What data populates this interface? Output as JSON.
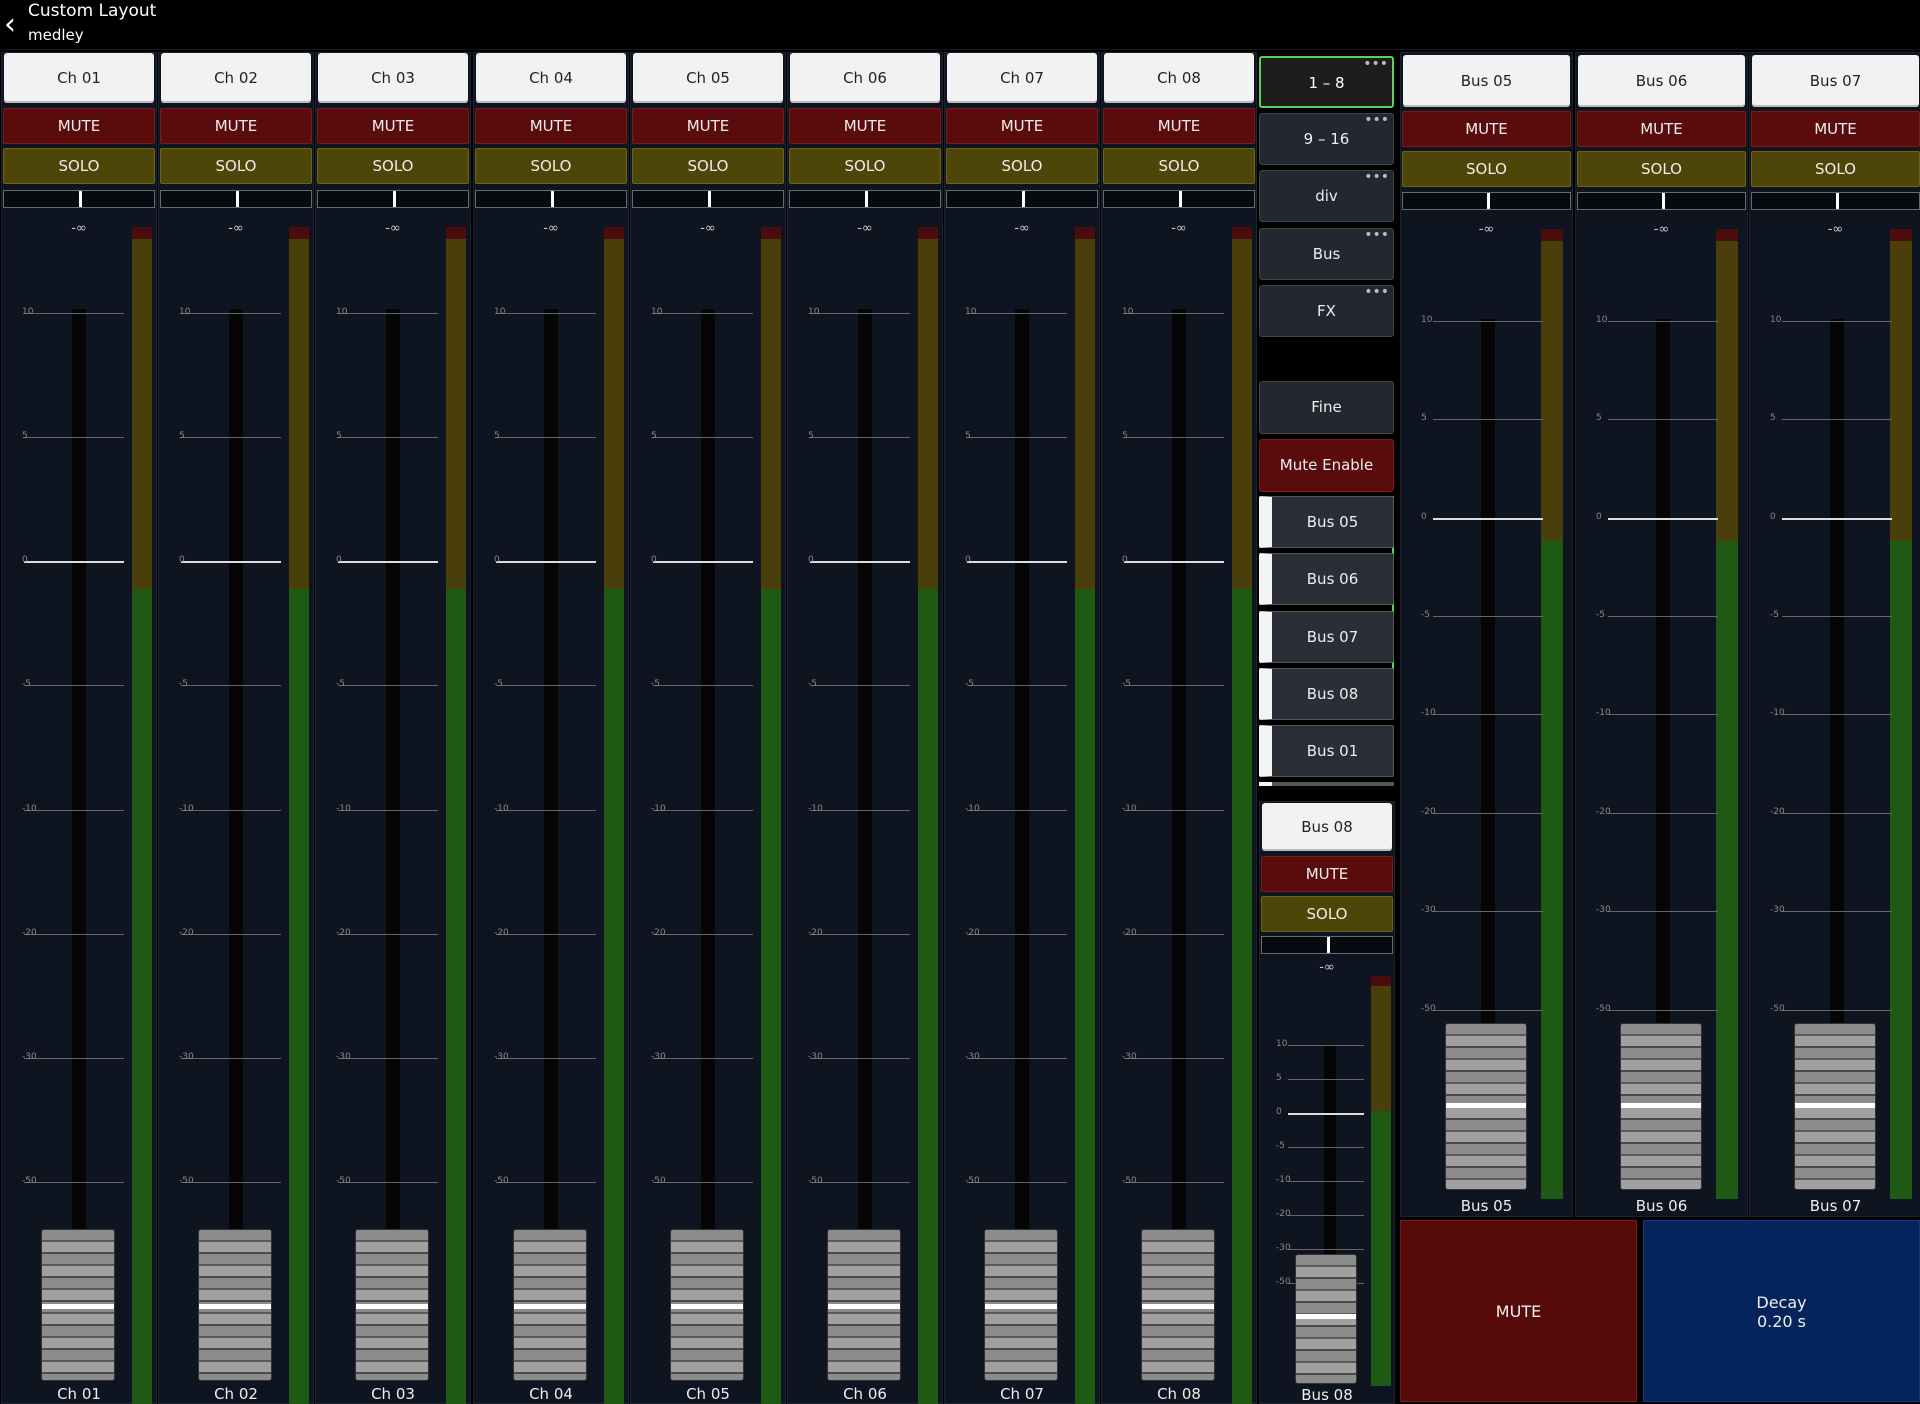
{
  "header": {
    "back_icon": "chevron-left-icon",
    "title": "Custom Layout",
    "subtitle": "medley"
  },
  "channels": [
    {
      "name": "Ch 01",
      "mute": "MUTE",
      "solo": "SOLO",
      "level": "-∞",
      "label": "Ch 01"
    },
    {
      "name": "Ch 02",
      "mute": "MUTE",
      "solo": "SOLO",
      "level": "-∞",
      "label": "Ch 02"
    },
    {
      "name": "Ch 03",
      "mute": "MUTE",
      "solo": "SOLO",
      "level": "-∞",
      "label": "Ch 03"
    },
    {
      "name": "Ch 04",
      "mute": "MUTE",
      "solo": "SOLO",
      "level": "-∞",
      "label": "Ch 04"
    },
    {
      "name": "Ch 05",
      "mute": "MUTE",
      "solo": "SOLO",
      "level": "-∞",
      "label": "Ch 05"
    },
    {
      "name": "Ch 06",
      "mute": "MUTE",
      "solo": "SOLO",
      "level": "-∞",
      "label": "Ch 06"
    },
    {
      "name": "Ch 07",
      "mute": "MUTE",
      "solo": "SOLO",
      "level": "-∞",
      "label": "Ch 07"
    },
    {
      "name": "Ch 08",
      "mute": "MUTE",
      "solo": "SOLO",
      "level": "-∞",
      "label": "Ch 08"
    }
  ],
  "scale_labels": [
    "10",
    "5",
    "0",
    "-5",
    "-10",
    "-20",
    "-30",
    "-50"
  ],
  "layer_buttons": [
    {
      "label": "1 – 8",
      "active": true
    },
    {
      "label": "9 – 16",
      "active": false
    },
    {
      "label": "div",
      "active": false
    },
    {
      "label": "Bus",
      "active": false
    },
    {
      "label": "FX",
      "active": false
    }
  ],
  "fine_label": "Fine",
  "mute_enable_label": "Mute Enable",
  "bus_list": [
    "Bus 05",
    "Bus 06",
    "Bus 07",
    "Bus 08",
    "Bus 01"
  ],
  "center_strip": {
    "name": "Bus 08",
    "mute": "MUTE",
    "solo": "SOLO",
    "level": "-∞",
    "label": "Bus 08"
  },
  "buses": [
    {
      "name": "Bus 05",
      "mute": "MUTE",
      "solo": "SOLO",
      "level": "-∞",
      "label": "Bus 05"
    },
    {
      "name": "Bus 06",
      "mute": "MUTE",
      "solo": "SOLO",
      "level": "-∞",
      "label": "Bus 06"
    },
    {
      "name": "Bus 07",
      "mute": "MUTE",
      "solo": "SOLO",
      "level": "-∞",
      "label": "Bus 07"
    }
  ],
  "big_mute_label": "MUTE",
  "decay": {
    "label": "Decay",
    "value": "0.20 s"
  },
  "colors": {
    "mute": "#5a0c0c",
    "solo": "#4e4608",
    "active_outline": "#57d357",
    "decay_bg": "#05245c"
  }
}
